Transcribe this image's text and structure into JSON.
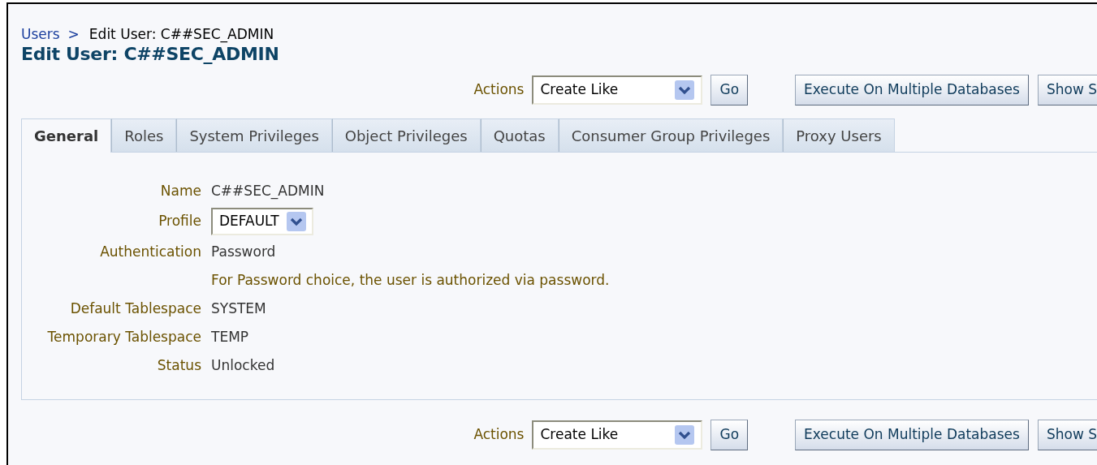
{
  "breadcrumb": {
    "link": "Users",
    "separator": ">",
    "current": "Edit User: C##SEC_ADMIN"
  },
  "title": "Edit User: C##SEC_ADMIN",
  "action_bars": [
    {
      "label": "Actions",
      "select": "Create Like",
      "go": "Go",
      "buttons": [
        "Execute On Multiple Databases",
        "Show S"
      ]
    },
    {
      "label": "Actions",
      "select": "Create Like",
      "go": "Go",
      "buttons": [
        "Execute On Multiple Databases",
        "Show S"
      ]
    }
  ],
  "tabs": [
    {
      "label": "General",
      "selected": true
    },
    {
      "label": "Roles",
      "selected": false
    },
    {
      "label": "System Privileges",
      "selected": false
    },
    {
      "label": "Object Privileges",
      "selected": false
    },
    {
      "label": "Quotas",
      "selected": false
    },
    {
      "label": "Consumer Group Privileges",
      "selected": false
    },
    {
      "label": "Proxy Users",
      "selected": false
    }
  ],
  "fields": [
    {
      "kind": "text",
      "label": "Name",
      "value": "C##SEC_ADMIN"
    },
    {
      "kind": "select",
      "label": "Profile",
      "value": "DEFAULT"
    },
    {
      "kind": "text",
      "label": "Authentication",
      "value": "Password"
    },
    {
      "kind": "hint",
      "value": "For Password choice, the user is authorized via password."
    },
    {
      "kind": "text",
      "label": "Default Tablespace",
      "value": "SYSTEM"
    },
    {
      "kind": "text",
      "label": "Temporary Tablespace",
      "value": "TEMP"
    },
    {
      "kind": "text",
      "label": "Status",
      "value": "Unlocked"
    }
  ]
}
